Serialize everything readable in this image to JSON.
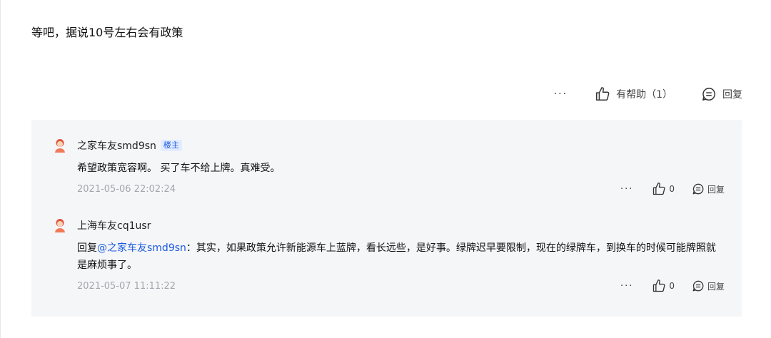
{
  "post": {
    "text": "等吧，据说10号左右会有政策",
    "more_label": "···",
    "helpful_label": "有帮助（1）",
    "reply_label": "回复"
  },
  "replies": [
    {
      "username": "之家车友smd9sn",
      "badge": "楼主",
      "content_prefix": "",
      "mention": "",
      "content": "希望政策宽容啊。 买了车不给上牌。真难受。",
      "time": "2021-05-06 22:02:24",
      "more_label": "···",
      "like_count": "0",
      "reply_label": "回复"
    },
    {
      "username": "上海车友cq1usr",
      "badge": "",
      "content_prefix": "回复",
      "mention": "@之家车友smd9sn",
      "content": "：其实，如果政策允许新能源车上蓝牌，看长远些，是好事。绿牌迟早要限制，现在的绿牌车，到换车的时候可能牌照就是麻烦事了。",
      "time": "2021-05-07 11:11:22",
      "more_label": "···",
      "like_count": "0",
      "reply_label": "回复"
    }
  ],
  "colors": {
    "link": "#1a5ae0",
    "reply_bg": "#f5f6f8",
    "timestamp": "#a3a6ad"
  }
}
